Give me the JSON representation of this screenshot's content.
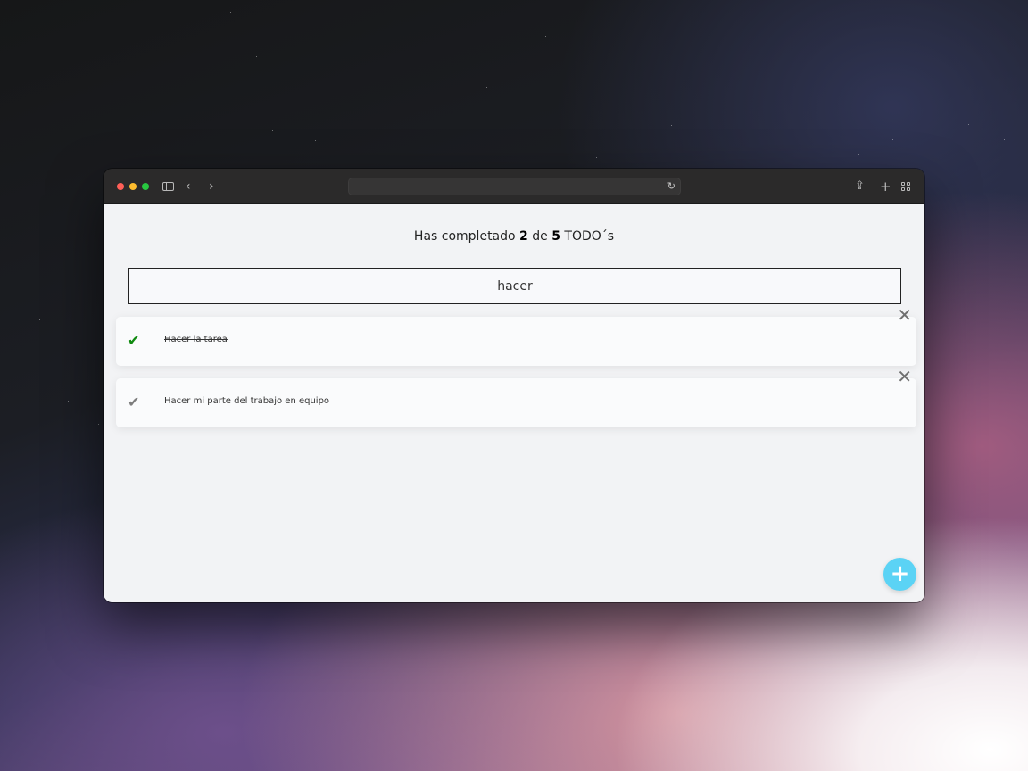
{
  "window": {
    "titlebar": {
      "back_icon": "‹",
      "forward_icon": "›",
      "reload_icon": "↻",
      "share_icon": "⇪",
      "new_tab_icon": "+"
    }
  },
  "app": {
    "counter": {
      "prefix": "Has completado",
      "completed": "2",
      "middle": "de",
      "total": "5",
      "suffix": "TODO´s"
    },
    "search": {
      "value": "hacer"
    },
    "todos": [
      {
        "text": "Hacer la tarea",
        "completed": true,
        "check_icon": "✔",
        "delete_icon": "✕"
      },
      {
        "text": "Hacer mi parte del trabajo en equipo",
        "completed": false,
        "check_icon": "✔",
        "delete_icon": "✕"
      }
    ],
    "add_button": {
      "icon": "+"
    }
  },
  "colors": {
    "completed_check": "#108a10",
    "pending_check": "#7d7d7d",
    "fab": "#5bd3f5"
  }
}
